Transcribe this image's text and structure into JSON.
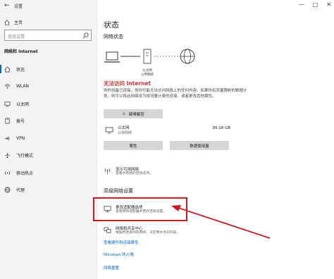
{
  "window": {
    "title": "设置",
    "controls": [
      "—",
      "□",
      "✕"
    ]
  },
  "sidebar": {
    "home_label": "主页",
    "search_placeholder": "查找设置",
    "section_label": "网络和 Internet",
    "items": [
      {
        "label": "状态",
        "icon": "home-icon",
        "active": true
      },
      {
        "label": "WLAN",
        "icon": "wifi-icon"
      },
      {
        "label": "以太网",
        "icon": "ethernet-icon"
      },
      {
        "label": "拨号",
        "icon": "dialup-icon"
      },
      {
        "label": "VPN",
        "icon": "vpn-icon"
      },
      {
        "label": "飞行模式",
        "icon": "airplane-icon"
      },
      {
        "label": "移动热点",
        "icon": "hotspot-icon"
      },
      {
        "label": "代理",
        "icon": "globe-icon"
      }
    ]
  },
  "main": {
    "title": "状态",
    "network_status_label": "网络状态",
    "diagram_label_line1": "以太网",
    "diagram_label_line2": "公用网络",
    "status_heading": "无法访问 Internet",
    "status_desc": "你的设备已连接，但你可能无法访问网络上的任何内容。如果你有流量限制的数据计划，则可以将此网络设为按流量计费的连接，或者更改其他属性。",
    "troubleshoot_label": "疑难解答",
    "adapter": {
      "name": "以太网",
      "sub": "公用网络",
      "size": "99.18 GB"
    },
    "properties_label": "属性",
    "data_usage_label": "数据使用量",
    "show_networks_title": "显示可用网络",
    "show_networks_sub": "查看你周围的连接选项。",
    "advanced_title": "高级网络设置",
    "change_adapter_title": "更改适配器选项",
    "change_adapter_sub": "查看网络适配器并更改连接设置。",
    "sharing_center_title": "网络和共享中心",
    "sharing_center_sub": "根据所连接到的网络，决定要共享的内容。",
    "links": [
      "查看硬件和连接属性",
      "Windows 防火墙",
      "网络重置"
    ]
  },
  "colors": {
    "accent": "#0067c0",
    "error": "#d13438",
    "highlight": "#d0161b"
  }
}
